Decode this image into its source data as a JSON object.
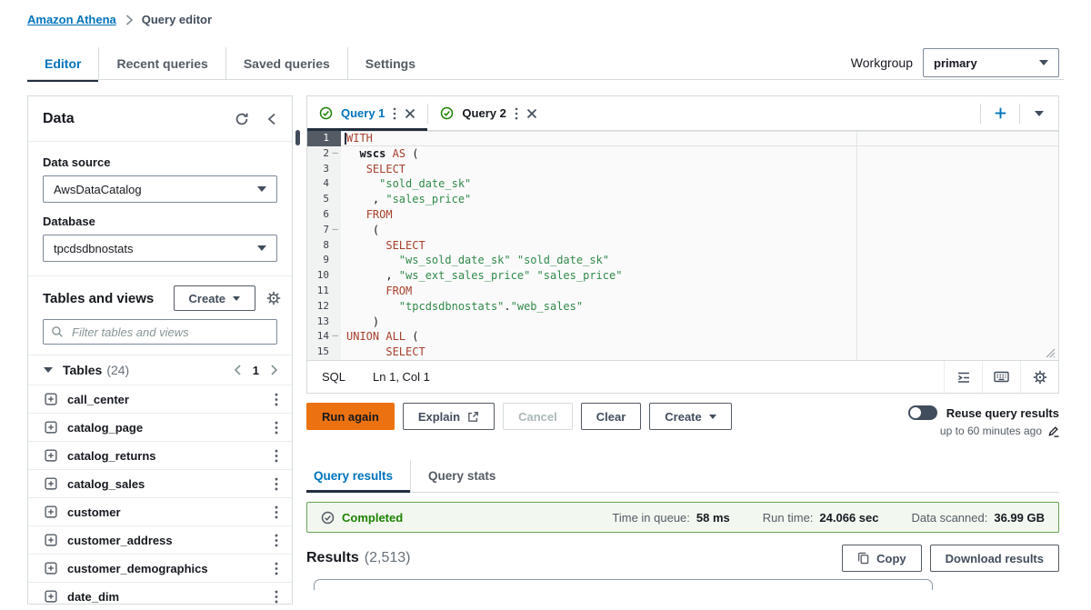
{
  "colors": {
    "link_blue": "#0073bb",
    "primary_orange": "#ec7211",
    "success_green": "#1d8102",
    "success_bg": "#f2f8f0",
    "code_keyword": "#a5402c",
    "code_string": "#318a4a",
    "active_gutter": "#545b64"
  },
  "icons": {
    "fold_marker": "–",
    "breadcrumb_separator": "›"
  },
  "breadcrumb": {
    "link": "Amazon Athena",
    "current": "Query editor"
  },
  "nav": {
    "tabs": [
      {
        "label": "Editor"
      },
      {
        "label": "Recent queries"
      },
      {
        "label": "Saved queries"
      },
      {
        "label": "Settings"
      }
    ]
  },
  "workgroup": {
    "label": "Workgroup",
    "value": "primary"
  },
  "sidebar": {
    "title": "Data",
    "data_source_label": "Data source",
    "data_source_value": "AwsDataCatalog",
    "database_label": "Database",
    "database_value": "tpcdsdbnostats",
    "tables_header": "Tables and views",
    "create_button": "Create",
    "filter_placeholder": "Filter tables and views",
    "tables_group": "Tables",
    "tables_count": "(24)",
    "page_number": "1",
    "tables": [
      "call_center",
      "catalog_page",
      "catalog_returns",
      "catalog_sales",
      "customer",
      "customer_address",
      "customer_demographics",
      "date_dim"
    ]
  },
  "editor": {
    "tabs": [
      {
        "label": "Query 1"
      },
      {
        "label": "Query 2"
      }
    ],
    "language": "SQL",
    "cursor_position": "Ln 1, Col 1",
    "code_lines": [
      {
        "n": 1,
        "fold": false,
        "seg": [
          [
            "kw",
            "WITH"
          ]
        ]
      },
      {
        "n": 2,
        "fold": true,
        "seg": [
          [
            "pl",
            "  "
          ],
          [
            "id",
            "wscs"
          ],
          [
            "pl",
            " "
          ],
          [
            "kw",
            "AS"
          ],
          [
            "pl",
            " ("
          ]
        ]
      },
      {
        "n": 3,
        "fold": false,
        "seg": [
          [
            "pl",
            "   "
          ],
          [
            "kw",
            "SELECT"
          ]
        ]
      },
      {
        "n": 4,
        "fold": false,
        "seg": [
          [
            "pl",
            "     "
          ],
          [
            "str",
            "\"sold_date_sk\""
          ]
        ]
      },
      {
        "n": 5,
        "fold": false,
        "seg": [
          [
            "pl",
            "    , "
          ],
          [
            "str",
            "\"sales_price\""
          ]
        ]
      },
      {
        "n": 6,
        "fold": false,
        "seg": [
          [
            "pl",
            "   "
          ],
          [
            "kw",
            "FROM"
          ]
        ]
      },
      {
        "n": 7,
        "fold": true,
        "seg": [
          [
            "pl",
            "    ("
          ]
        ]
      },
      {
        "n": 8,
        "fold": false,
        "seg": [
          [
            "pl",
            "      "
          ],
          [
            "kw",
            "SELECT"
          ]
        ]
      },
      {
        "n": 9,
        "fold": false,
        "seg": [
          [
            "pl",
            "        "
          ],
          [
            "str",
            "\"ws_sold_date_sk\""
          ],
          [
            "pl",
            " "
          ],
          [
            "str",
            "\"sold_date_sk\""
          ]
        ]
      },
      {
        "n": 10,
        "fold": false,
        "seg": [
          [
            "pl",
            "      , "
          ],
          [
            "str",
            "\"ws_ext_sales_price\""
          ],
          [
            "pl",
            " "
          ],
          [
            "str",
            "\"sales_price\""
          ]
        ]
      },
      {
        "n": 11,
        "fold": false,
        "seg": [
          [
            "pl",
            "      "
          ],
          [
            "kw",
            "FROM"
          ]
        ]
      },
      {
        "n": 12,
        "fold": false,
        "seg": [
          [
            "pl",
            "        "
          ],
          [
            "str",
            "\"tpcdsdbnostats\""
          ],
          [
            "pl",
            "."
          ],
          [
            "str",
            "\"web_sales\""
          ]
        ]
      },
      {
        "n": 13,
        "fold": false,
        "seg": [
          [
            "pl",
            "    )"
          ]
        ]
      },
      {
        "n": 14,
        "fold": true,
        "seg": [
          [
            "kw",
            "UNION"
          ],
          [
            "pl",
            " "
          ],
          [
            "kw",
            "ALL"
          ],
          [
            "pl",
            " ("
          ]
        ]
      },
      {
        "n": 15,
        "fold": false,
        "seg": [
          [
            "pl",
            "      "
          ],
          [
            "kw",
            "SELECT"
          ]
        ]
      }
    ]
  },
  "actions": {
    "run": "Run again",
    "explain": "Explain",
    "cancel": "Cancel",
    "clear": "Clear",
    "create": "Create",
    "reuse_toggle_label": "Reuse query results",
    "reuse_note": "up to 60 minutes ago"
  },
  "results": {
    "tabs": [
      {
        "label": "Query results"
      },
      {
        "label": "Query stats"
      }
    ],
    "status_label": "Completed",
    "metrics": [
      {
        "label": "Time in queue:",
        "value": "58 ms"
      },
      {
        "label": "Run time:",
        "value": "24.066 sec"
      },
      {
        "label": "Data scanned:",
        "value": "36.99 GB"
      }
    ],
    "title": "Results",
    "count": "(2,513)",
    "copy_button": "Copy",
    "download_button": "Download results"
  }
}
